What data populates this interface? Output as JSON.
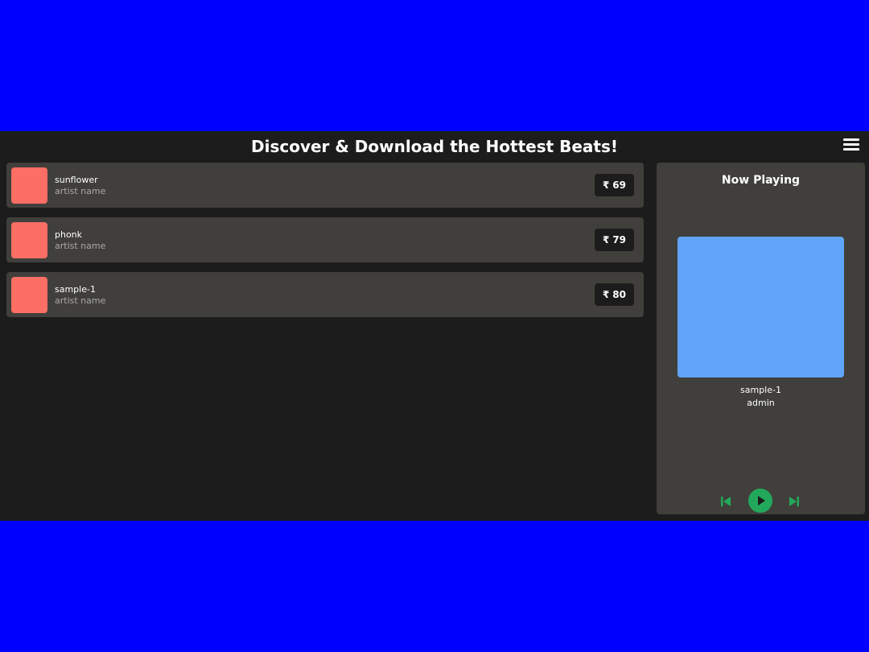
{
  "header": {
    "title": "Discover & Download the Hottest Beats!",
    "menu_icon": "hamburger-menu-icon"
  },
  "tracks": [
    {
      "title": "sunflower",
      "artist": "artist name",
      "currency": "₹",
      "price": "69"
    },
    {
      "title": "phonk",
      "artist": "artist name",
      "currency": "₹",
      "price": "79"
    },
    {
      "title": "sample-1",
      "artist": "artist name",
      "currency": "₹",
      "price": "80"
    }
  ],
  "now_playing": {
    "heading": "Now Playing",
    "title": "sample-1",
    "artist": "admin",
    "controls": {
      "prev_icon": "skip-previous-icon",
      "play_icon": "play-icon",
      "next_icon": "skip-next-icon"
    }
  },
  "colors": {
    "outer_background": "#0000ff",
    "app_background": "#1c1c1c",
    "card_background": "#403f3b",
    "thumbnail": "#fd6e64",
    "album_art": "#60a5fa",
    "accent_green": "#22a85a"
  }
}
